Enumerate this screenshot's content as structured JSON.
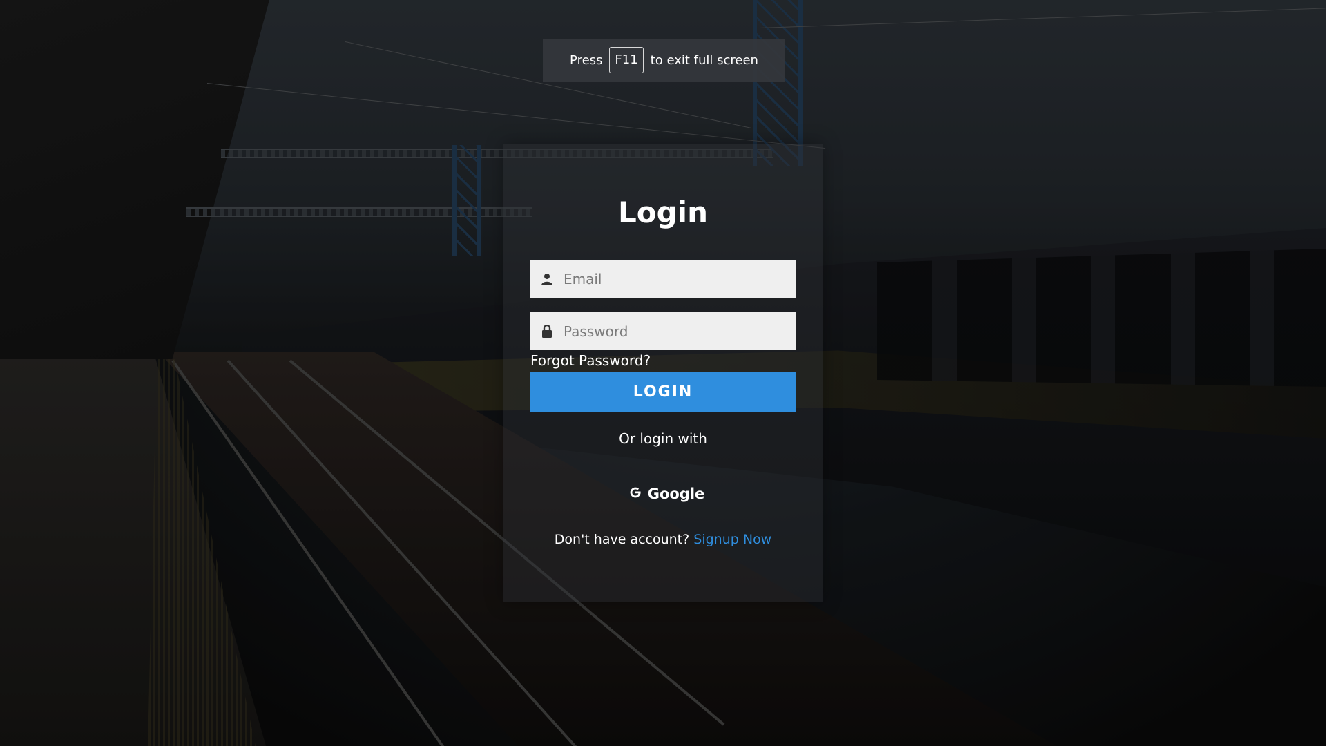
{
  "notice": {
    "press": "Press",
    "key": "F11",
    "suffix": "to exit full screen"
  },
  "login": {
    "title": "Login",
    "email_placeholder": "Email",
    "password_placeholder": "Password",
    "forgot_label": "Forgot Password?",
    "submit_label": "LOGIN",
    "alt_label": "Or login with",
    "google_label": "Google",
    "signup_prompt": "Don't have account?",
    "signup_link": "Signup Now"
  },
  "colors": {
    "accent": "#2f8ede",
    "input_bg": "#efefef",
    "text": "#ffffff"
  },
  "icons": {
    "email": "user-icon",
    "password": "lock-icon",
    "google": "google-icon"
  }
}
